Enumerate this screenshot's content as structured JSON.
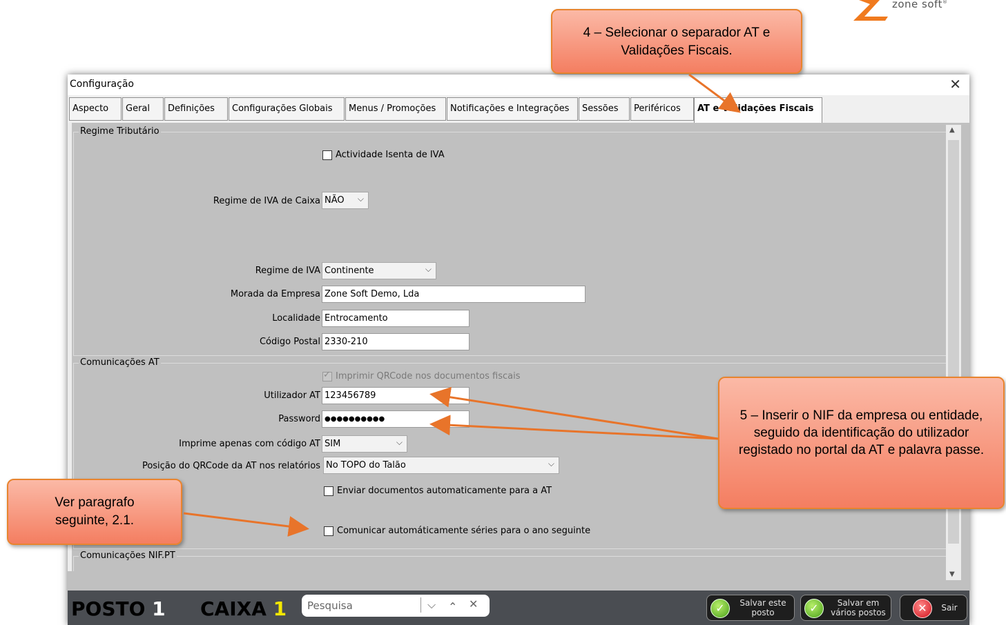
{
  "logo": {
    "text": "zone soft",
    "reg": "®",
    "accent": "#f07a1e"
  },
  "window": {
    "title": "Configuração",
    "close": "✕",
    "tabs": [
      {
        "label": "Aspecto"
      },
      {
        "label": "Geral"
      },
      {
        "label": "Definições"
      },
      {
        "label": "Configurações Globais"
      },
      {
        "label": "Menus / Promoções"
      },
      {
        "label": "Notificações e Integrações"
      },
      {
        "label": "Sessões"
      },
      {
        "label": "Periféricos"
      },
      {
        "label": "AT e Validações Fiscais",
        "active": true
      }
    ]
  },
  "regime": {
    "legend": "Regime Tributário",
    "isenta_label": "Actividade Isenta de IVA",
    "iva_caixa_label": "Regime de IVA de Caixa",
    "iva_caixa_value": "NÃO",
    "regime_iva_label": "Regime de IVA",
    "regime_iva_value": "Continente",
    "morada_label": "Morada da Empresa",
    "morada_value": "Zone Soft Demo, Lda",
    "localidade_label": "Localidade",
    "localidade_value": "Entrocamento",
    "codigo_postal_label": "Código Postal",
    "codigo_postal_value": "2330-210"
  },
  "comunicacoes": {
    "legend": "Comunicações AT",
    "qrcode_label": "Imprimir QRCode nos documentos fiscais",
    "utilizador_label": "Utilizador AT",
    "utilizador_value": "123456789",
    "password_label": "Password",
    "password_value": "●●●●●●●●●●",
    "imprime_label": "Imprime apenas com código AT",
    "imprime_value": "SIM",
    "posicao_label": "Posição do QRCode da AT nos relatórios",
    "posicao_value": "No TOPO do Talão",
    "enviar_label": "Enviar documentos automaticamente para a AT",
    "comunicar_label": "Comunicar automáticamente séries para o ano seguinte"
  },
  "nif": {
    "legend": "Comunicações NIF.PT"
  },
  "bottom": {
    "posto": "POSTO",
    "posto_num": "1",
    "caixa": "CAIXA",
    "caixa_num": "1",
    "search_placeholder": "Pesquisa",
    "btn_salvar_posto": "Salvar este posto",
    "btn_salvar_varios": "Salvar em vários postos",
    "btn_sair": "Sair"
  },
  "callouts": {
    "step4": "4 – Selecionar o separador AT e Validações Fiscais.",
    "step5": "5 – Inserir o NIF da empresa ou entidade, seguido da identificação do utilizador registado no portal da AT e palavra passe.",
    "ver": "Ver paragrafo seguinte, 2.1."
  },
  "colors": {
    "callout_fill": "#f4866a",
    "callout_border": "#e8842e",
    "arrow": "#e8742a"
  }
}
